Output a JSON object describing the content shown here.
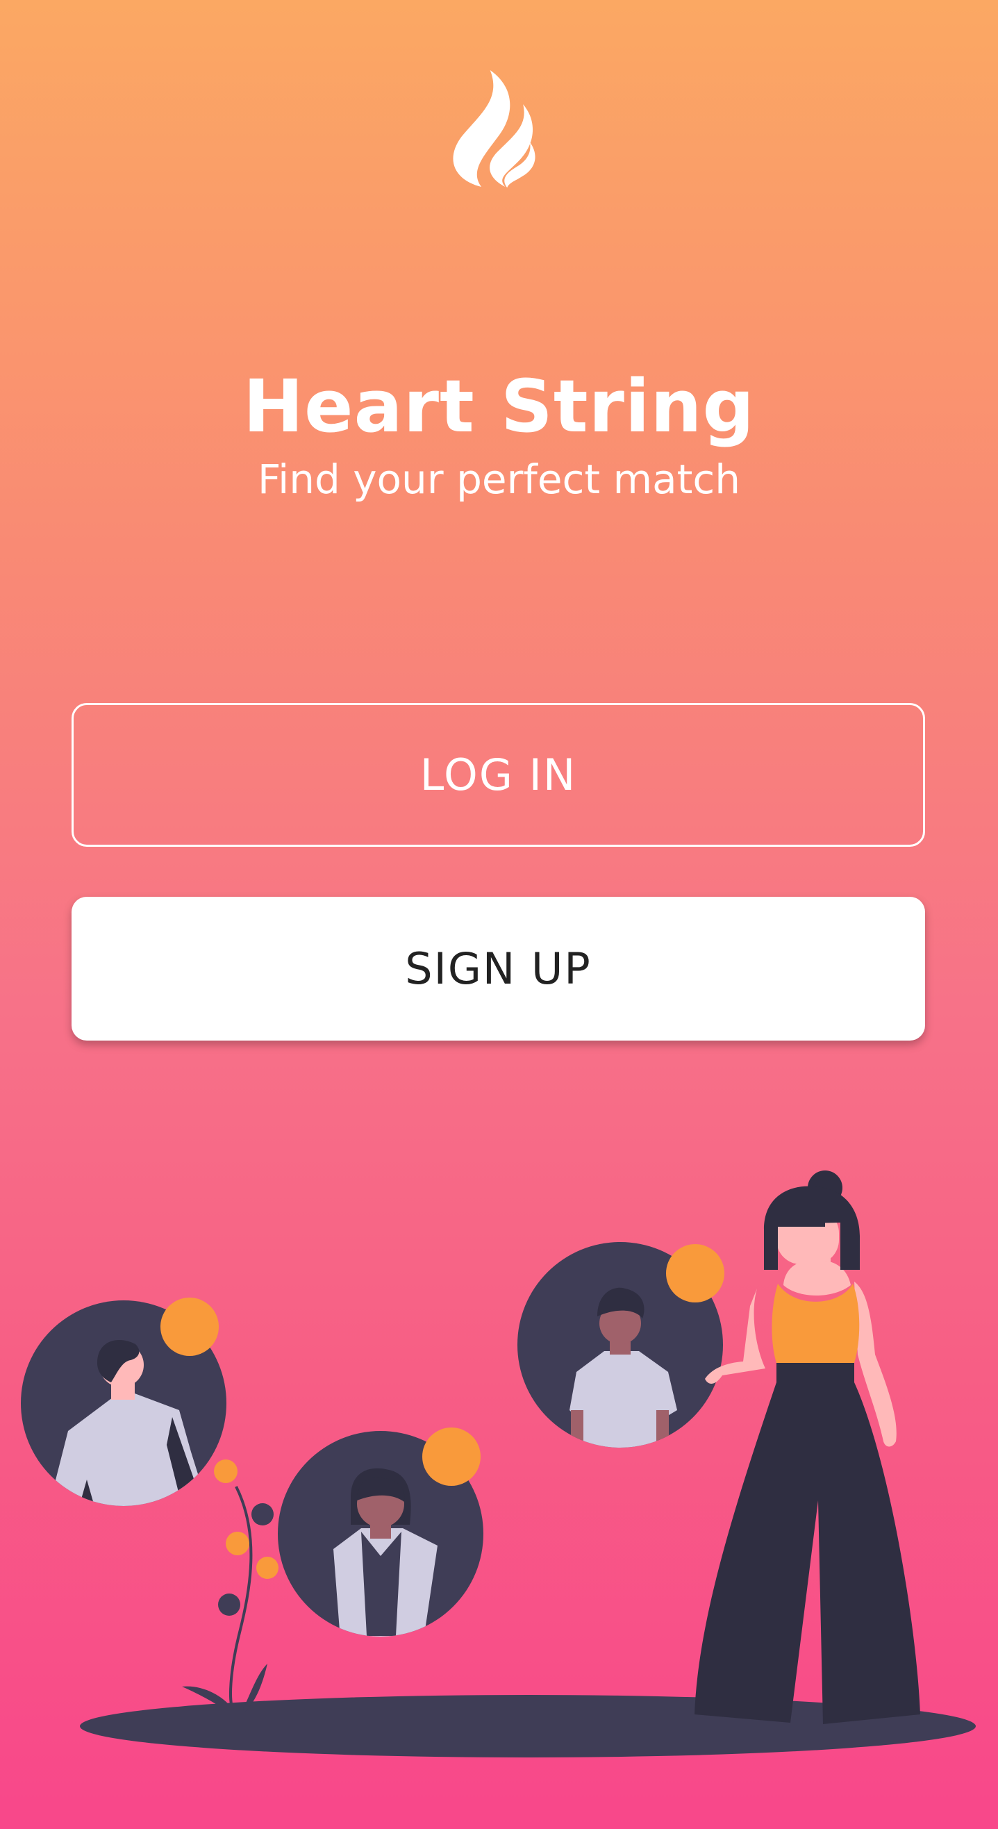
{
  "app": {
    "name": "Heart String",
    "tagline": "Find your perfect match"
  },
  "actions": {
    "login_label": "LOG IN",
    "signup_label": "SIGN UP"
  },
  "icons": {
    "logo": "flame-logo-icon"
  },
  "colors": {
    "gradient_top": "#FBA863",
    "gradient_bottom": "#F8478A",
    "dark": "#3F3D56",
    "accent_orange": "#F99A3B",
    "button_text": "#222222"
  }
}
